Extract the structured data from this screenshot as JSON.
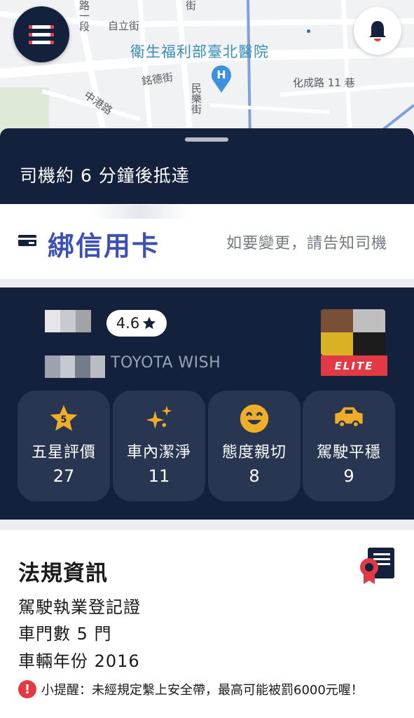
{
  "map": {
    "labels": [
      "自立街",
      "衛生福利部臺北醫院",
      "銘德街",
      "化成路 11 巷",
      "中港路",
      "民樂街",
      "街",
      "路一段"
    ],
    "hospital_marker": "H"
  },
  "header": {
    "menu_icon": "hamburger-menu-icon",
    "bell_icon": "bell-icon"
  },
  "trip": {
    "eta_text": "司機約 6 分鐘後抵達"
  },
  "payment": {
    "icon": "credit-card-icon",
    "label": "綁信用卡",
    "note": "如要變更，請告知司機"
  },
  "driver": {
    "rating": "4.6",
    "car_model": "TOYOTA WISH",
    "badge": "ELITE",
    "stats": [
      {
        "icon": "five-star-icon",
        "icon_text": "5",
        "label": "五星評價",
        "count": "27"
      },
      {
        "icon": "sparkle-icon",
        "label": "車內潔淨",
        "count": "11"
      },
      {
        "icon": "smile-face-icon",
        "label": "態度親切",
        "count": "8"
      },
      {
        "icon": "car-icon",
        "label": "駕駛平穩",
        "count": "9"
      }
    ]
  },
  "regulation": {
    "title": "法規資訊",
    "lines": [
      "駕駛執業登記證",
      "車門數 5 門",
      "車輛年份 2016"
    ],
    "reminder": "小提醒：未經規定繫上安全帶，最高可能被罰6000元喔！",
    "warning_symbol": "!"
  },
  "colors": {
    "navy": "#13213d",
    "card_navy": "#283652",
    "accent_red": "#e23a45",
    "payment_blue": "#3c4fb3",
    "icon_gold": "#f0ad28"
  }
}
